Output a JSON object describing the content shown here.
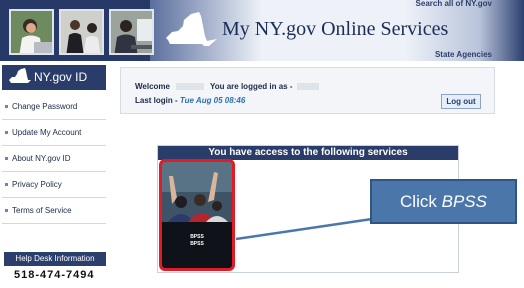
{
  "header": {
    "site_title": "My NY.gov Online Services",
    "search_link": "Search all of NY.gov",
    "agencies_link": "State Agencies"
  },
  "sidebar": {
    "title": "NY.gov ID",
    "items": [
      {
        "label": "Change Password"
      },
      {
        "label": "Update My Account"
      },
      {
        "label": "About NY.gov ID"
      },
      {
        "label": "Privacy Policy"
      },
      {
        "label": "Terms of Service"
      }
    ],
    "help_desk": {
      "title": "Help Desk Information",
      "phone": "518-474-7494"
    }
  },
  "welcome": {
    "welcome_label": "Welcome",
    "logged_in_label": "You are logged in as -",
    "last_login_label": "Last login -",
    "last_login_value": "Tue Aug 05 08:46",
    "logout_label": "Log out"
  },
  "services": {
    "heading": "You have access to the following services",
    "tiles": [
      {
        "line1": "BPSS",
        "line2": "BPSS"
      }
    ]
  },
  "callout": {
    "prefix": "Click",
    "target": "BPSS"
  },
  "colors": {
    "header_navy": "#2a3c6a",
    "highlight_red": "#e21b25",
    "callout_blue": "#4a76aa",
    "date_blue": "#2c6fb0"
  }
}
